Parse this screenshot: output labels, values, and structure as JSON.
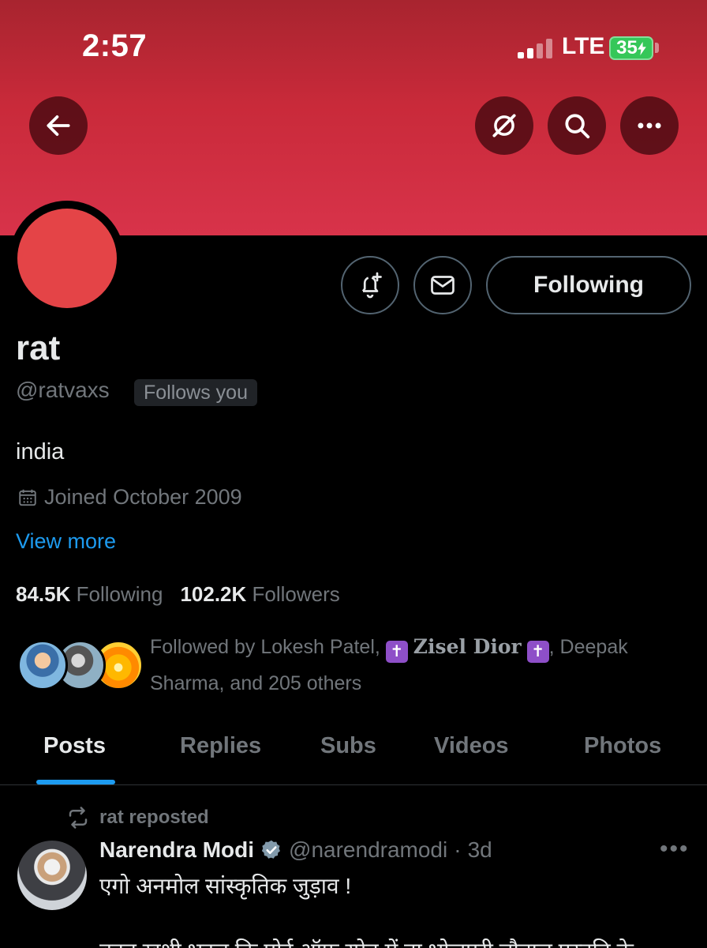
{
  "status_bar": {
    "time": "2:57",
    "network": "LTE",
    "battery": "35"
  },
  "header": {
    "back_icon": "arrow-left-icon",
    "grok_icon": "grok-icon",
    "search_icon": "search-icon",
    "more_icon": "more-horizontal-icon",
    "banner_color": "#d8334a"
  },
  "profile": {
    "avatar_color": "#e44447",
    "display_name": "rat",
    "handle": "@ratvaxs",
    "follows_you": "Follows you",
    "bio": "india",
    "joined": "Joined October 2009",
    "view_more": "View more",
    "following_count": "84.5K",
    "following_label": "Following",
    "followers_count": "102.2K",
    "followers_label": "Followers"
  },
  "actions": {
    "notify_icon": "bell-plus-icon",
    "message_icon": "envelope-icon",
    "following_button": "Following"
  },
  "followed_by": {
    "prefix": "Followed by Lokesh Patel,",
    "emoji": "✝️",
    "fancy_name": "𝐙𝐢𝐬𝐞𝐥 𝐃𝐢𝐨𝐫",
    "suffix": ", Deepak Sharma, and 205 others"
  },
  "tabs": [
    {
      "label": "Posts",
      "active": true
    },
    {
      "label": "Replies",
      "active": false
    },
    {
      "label": "Subs",
      "active": false
    },
    {
      "label": "Videos",
      "active": false
    },
    {
      "label": "Photos",
      "active": false
    }
  ],
  "post": {
    "repost_label": "rat reposted",
    "author": "Narendra Modi",
    "author_handle": "@narendramodi",
    "separator": "·",
    "time": "3d",
    "more": "•••",
    "text": "एगो अनमोल सांस्कृतिक जुड़ाव !",
    "text_partial": "बहुत खुशी भइल कि पोर्ट ऑफ स्पेन में ना भोजपुरी चौताल प्रस्तुति के"
  },
  "accent_color": "#1d9bf0"
}
